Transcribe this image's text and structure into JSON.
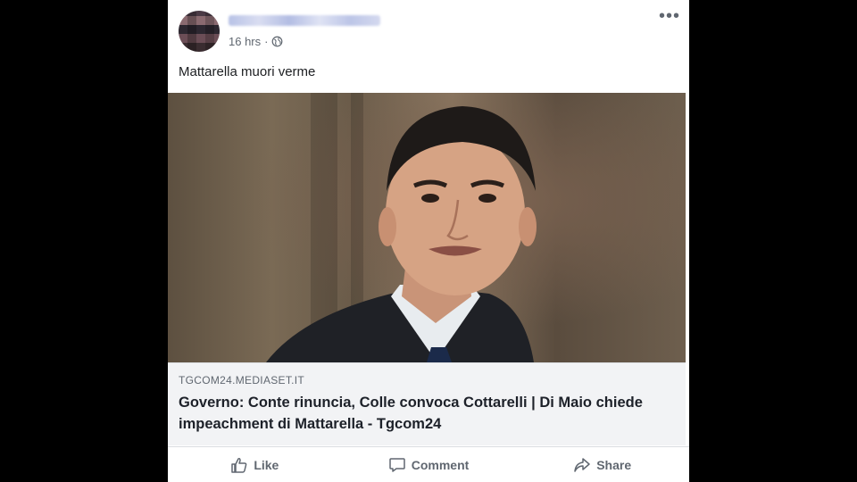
{
  "post": {
    "timestamp": "16 hrs",
    "separator": "·",
    "privacy_icon": "globe-icon",
    "more_glyph": "•••",
    "text": "Mattarella muori verme"
  },
  "link_preview": {
    "domain": "TGCOM24.MEDIASET.IT",
    "headline": "Governo: Conte rinuncia, Colle convoca Cottarelli | Di Maio chiede impeachment di Mattarella - Tgcom24"
  },
  "actions": {
    "like": "Like",
    "comment": "Comment",
    "share": "Share"
  }
}
